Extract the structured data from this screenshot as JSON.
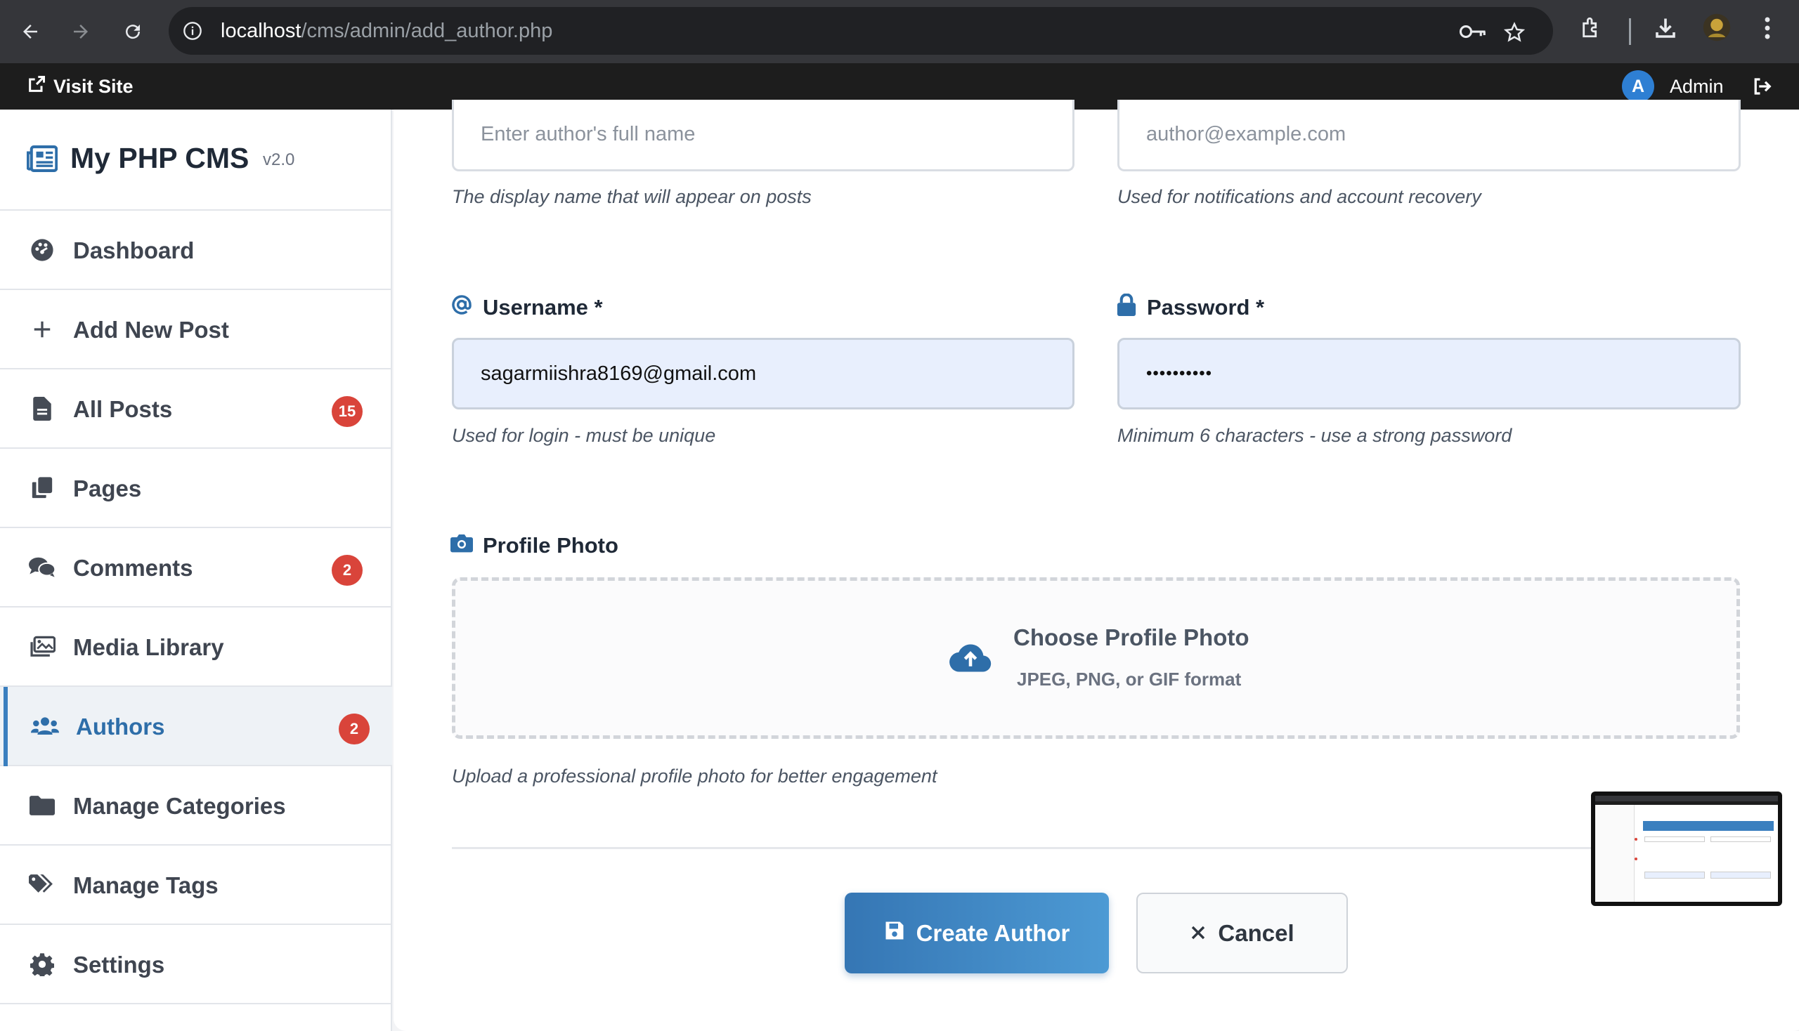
{
  "browser": {
    "url_host": "localhost",
    "url_path": "/cms/admin/add_author.php",
    "icons": [
      "back-arrow-icon",
      "forward-arrow-icon",
      "reload-icon",
      "site-info-icon",
      "password-key-icon",
      "bookmark-star-icon",
      "extensions-icon",
      "download-icon",
      "profile-avatar-icon",
      "kebab-menu-icon"
    ]
  },
  "topbar": {
    "visit_site": "Visit Site",
    "avatar_letter": "A",
    "user_name": "Admin"
  },
  "brand": {
    "name": "My PHP CMS",
    "version": "v2.0"
  },
  "sidebar": {
    "items": [
      {
        "label": "Dashboard",
        "icon": "palette-icon",
        "badge": ""
      },
      {
        "label": "Add New Post",
        "icon": "plus-icon",
        "badge": ""
      },
      {
        "label": "All Posts",
        "icon": "file-icon",
        "badge": "15"
      },
      {
        "label": "Pages",
        "icon": "copy-icon",
        "badge": ""
      },
      {
        "label": "Comments",
        "icon": "comments-icon",
        "badge": "2"
      },
      {
        "label": "Media Library",
        "icon": "images-icon",
        "badge": ""
      },
      {
        "label": "Authors",
        "icon": "users-icon",
        "badge": "2",
        "active": true
      },
      {
        "label": "Manage Categories",
        "icon": "folder-icon",
        "badge": ""
      },
      {
        "label": "Manage Tags",
        "icon": "tags-icon",
        "badge": ""
      },
      {
        "label": "Settings",
        "icon": "gear-icon",
        "badge": ""
      }
    ]
  },
  "form": {
    "full_name": {
      "placeholder": "Enter author's full name",
      "help": "The display name that will appear on posts"
    },
    "email": {
      "placeholder": "author@example.com",
      "help": "Used for notifications and account recovery"
    },
    "username": {
      "label": "Username *",
      "value": "sagarmiishra8169@gmail.com",
      "help": "Used for login - must be unique"
    },
    "password": {
      "label": "Password *",
      "value": "••••••••••",
      "help": "Minimum 6 characters - use a strong password"
    },
    "photo": {
      "label": "Profile Photo",
      "choose": "Choose Profile Photo",
      "formats": "JPEG, PNG, or GIF format",
      "help": "Upload a professional profile photo for better engagement"
    },
    "create_label": "Create Author",
    "cancel_label": "Cancel"
  },
  "colors": {
    "accent": "#3a7fbf",
    "badge": "#d9443a",
    "topbar": "#1d1d1d",
    "chrome": "#35363a"
  }
}
